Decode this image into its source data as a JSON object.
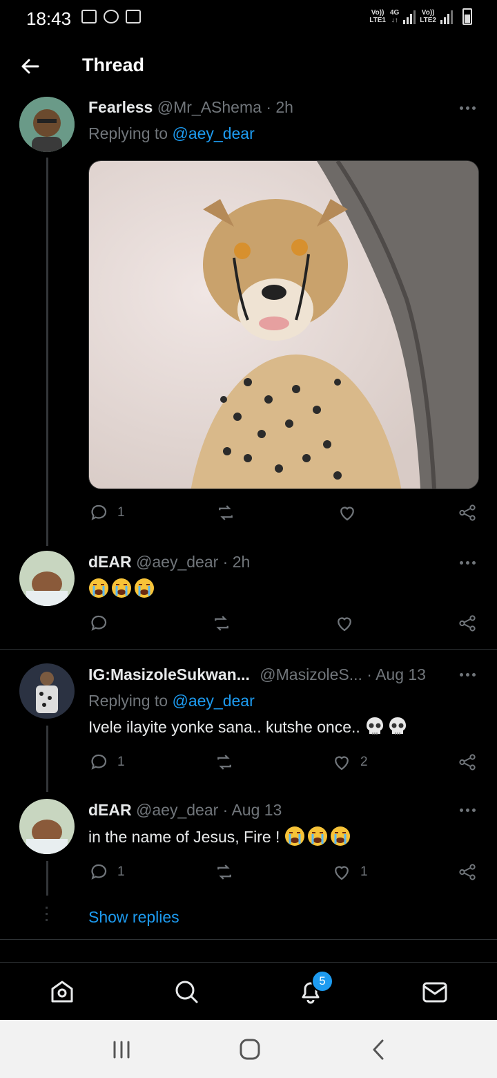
{
  "status_bar": {
    "time": "18:43",
    "sim1_top": "Vo))",
    "sim1_bottom": "LTE1",
    "net_top": "4G",
    "net_bottom": "↓↑",
    "sim2_top": "Vo))",
    "sim2_bottom": "LTE2"
  },
  "header": {
    "title": "Thread",
    "back_icon": "arrow-left-icon"
  },
  "tweets": [
    {
      "name": "Fearless",
      "handle": "@Mr_AShema",
      "time": "· 2h",
      "replying_prefix": "Replying to",
      "replying_to": "@aey_dear",
      "reply_count": "1",
      "like_count": "",
      "has_media": true
    },
    {
      "name": "dEAR",
      "handle": "@aey_dear",
      "time": "· 2h",
      "emojis": 3,
      "reply_count": "",
      "like_count": ""
    },
    {
      "name": "IG:MasizoleSukwan...",
      "handle": "@MasizoleS...",
      "time": "· Aug 13",
      "replying_prefix": "Replying to",
      "replying_to": "@aey_dear",
      "text": "Ivele ilayite yonke sana.. kutshe once..",
      "emoji_skulls": 2,
      "reply_count": "1",
      "like_count": "2"
    },
    {
      "name": "dEAR",
      "handle": "@aey_dear",
      "time": "· Aug 13",
      "text": "in the name of Jesus, Fire !",
      "emojis": 3,
      "reply_count": "1",
      "like_count": "1"
    }
  ],
  "show_replies": "Show replies",
  "bottom_nav": {
    "items": [
      "home-icon",
      "search-icon",
      "notifications-icon",
      "messages-icon"
    ],
    "notification_badge": "5"
  },
  "colors": {
    "background": "#000000",
    "accent": "#1d9bf0",
    "muted": "#71767b",
    "text": "#e7e9ea"
  }
}
